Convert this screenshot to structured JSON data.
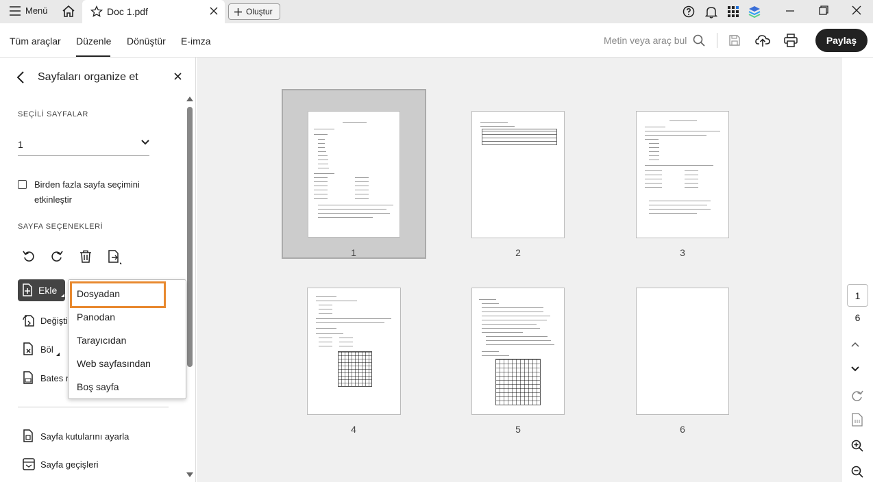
{
  "titlebar": {
    "menu_label": "Menü",
    "doc_tab_name": "Doc 1.pdf",
    "create_label": "Oluştur"
  },
  "toolbar": {
    "tabs": [
      "Tüm araçlar",
      "Düzenle",
      "Dönüştür",
      "E-imza"
    ],
    "active_tab": "Düzenle",
    "search_placeholder": "Metin veya araç bul",
    "share_label": "Paylaş"
  },
  "panel": {
    "title": "Sayfaları organize et",
    "selected_pages_label": "SEÇİLİ SAYFALAR",
    "selected_value": "1",
    "multi_select_label": "Birden fazla sayfa seçimini etkinleştir",
    "page_options_label": "SAYFA SEÇENEKLERİ",
    "insert_label": "Ekle",
    "replace_label": "Değişti",
    "split_label": "Böl",
    "bates_label": "Bates n",
    "page_boxes_label": "Sayfa kutularını ayarla",
    "page_transitions_label": "Sayfa geçişleri"
  },
  "dropdown": {
    "items": [
      "Dosyadan",
      "Panodan",
      "Tarayıcıdan",
      "Web sayfasından",
      "Boş sayfa"
    ],
    "highlighted": "Dosyadan"
  },
  "pages": [
    {
      "number": "1",
      "selected": true
    },
    {
      "number": "2",
      "selected": false
    },
    {
      "number": "3",
      "selected": false
    },
    {
      "number": "4",
      "selected": false
    },
    {
      "number": "5",
      "selected": false
    },
    {
      "number": "6",
      "selected": false
    }
  ],
  "rail": {
    "current_page": "1",
    "total_pages": "6"
  },
  "colors": {
    "highlight": "#e8892f",
    "share_bg": "#222222",
    "insert_bg": "#444444"
  }
}
